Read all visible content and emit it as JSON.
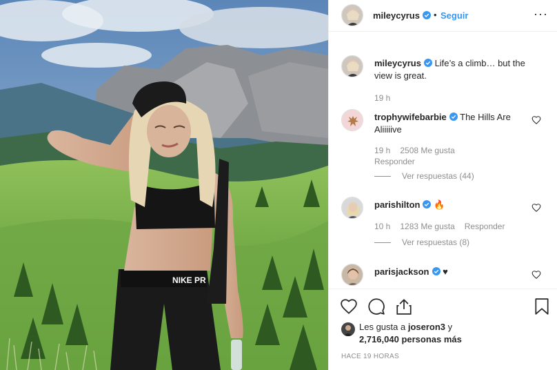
{
  "post": {
    "username": "mileycyrus",
    "follow_label": "Seguir",
    "separator": "•",
    "more_label": "···"
  },
  "caption": {
    "username": "mileycyrus",
    "text": "Life’s a climb… but the view is great.",
    "time": "19 h"
  },
  "comments": [
    {
      "username": "trophywifebarbie",
      "text": "The Hills Are Aliiiiive",
      "time": "19 h",
      "likes": "2508 Me gusta",
      "reply": "Responder",
      "view_replies": "Ver respuestas (44)"
    },
    {
      "username": "parishilton",
      "text": "🔥",
      "time": "10 h",
      "likes": "1283 Me gusta",
      "reply": "Responder",
      "view_replies": "Ver respuestas (8)"
    },
    {
      "username": "parisjackson",
      "text": "♥"
    }
  ],
  "likes": {
    "prefix": "Les gusta a ",
    "user": "joseron3",
    "middle": " y",
    "count": "2,716,040 personas más"
  },
  "timestamp": "HACE 19 HORAS",
  "icons": {
    "like": "heart-icon",
    "comment": "comment-icon",
    "share": "share-icon",
    "save": "bookmark-icon",
    "verified": "verified-badge-icon"
  },
  "colors": {
    "link": "#3897f0",
    "verified": "#3897f0",
    "muted": "#8e8e8e"
  }
}
